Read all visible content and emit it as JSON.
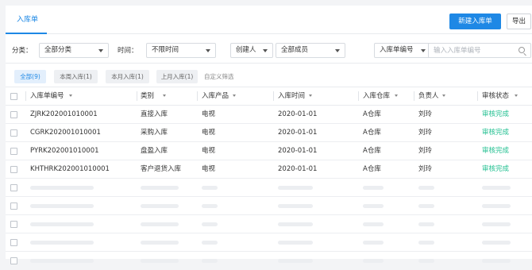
{
  "header": {
    "tab_label": "入库单",
    "new_button": "新建入库单",
    "export_button": "导出"
  },
  "filters": {
    "category_label": "分类：",
    "category_value": "全部分类",
    "time_label": "时间：",
    "time_value": "不限时间",
    "creator_value": "创建人",
    "member_value": "全部成员",
    "field_value": "入库单编号",
    "search_placeholder": "输入入库单编号"
  },
  "chips": {
    "all": "全部(9)",
    "this_week": "本周入库(1)",
    "this_month": "本月入库(1)",
    "last_month": "上月入库(1)",
    "custom": "自定义筛选"
  },
  "table": {
    "columns": [
      "入库单编号",
      "类别",
      "入库产品",
      "入库时间",
      "入库仓库",
      "负责人",
      "审核状态"
    ],
    "rows": [
      {
        "code": "ZJRK202001010001",
        "type": "直接入库",
        "product": "电视",
        "date": "2020-01-01",
        "warehouse": "A仓库",
        "owner": "刘玲",
        "status": "审核完成"
      },
      {
        "code": "CGRK202001010001",
        "type": "采购入库",
        "product": "电视",
        "date": "2020-01-01",
        "warehouse": "A仓库",
        "owner": "刘玲",
        "status": "审核完成"
      },
      {
        "code": "PYRK202001010001",
        "type": "盘盈入库",
        "product": "电视",
        "date": "2020-01-01",
        "warehouse": "A仓库",
        "owner": "刘玲",
        "status": "审核完成"
      },
      {
        "code": "KHTHRK202001010001",
        "type": "客户退货入库",
        "product": "电视",
        "date": "2020-01-01",
        "warehouse": "A仓库",
        "owner": "刘玲",
        "status": "审核完成"
      }
    ],
    "status_color": "#1fbf8f"
  },
  "colors": {
    "accent": "#1e88e5"
  }
}
